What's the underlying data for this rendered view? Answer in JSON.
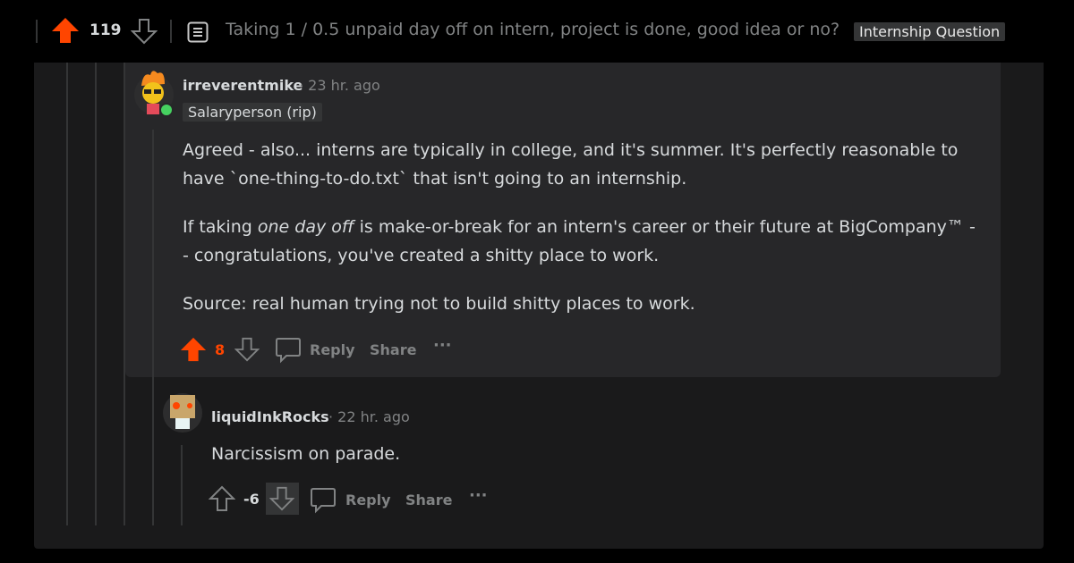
{
  "post": {
    "score": "119",
    "title": "Taking 1 / 0.5 unpaid day off on intern, project is done, good idea or no?",
    "flair": "Internship Question"
  },
  "colors": {
    "upvote": "#ff4500",
    "panel": "#1a1a1b",
    "highlight": "#272729"
  },
  "comments": [
    {
      "author": "irreverentmike",
      "time": "· 23 hr. ago",
      "flair": "Salaryperson (rip)",
      "online": true,
      "p1": "Agreed - also... interns are typically in college, and it's summer. It's perfectly reasonable to have `one-thing-to-do.txt` that isn't going to an internship.",
      "p2_pre": "If taking ",
      "p2_em": "one day off",
      "p2_post": " is make-or-break for an intern's career or their future at BigCompany™ -- congratulations, you've created a shitty place to work.",
      "p3": "Source: real human trying not to build shitty places to work.",
      "score": "8",
      "vote": "up",
      "reply": "Reply",
      "share": "Share",
      "more": "···"
    },
    {
      "author": "liquidInkRocks",
      "time": "· 22 hr. ago",
      "body": "Narcissism on parade.",
      "score": "-6",
      "vote": "down",
      "reply": "Reply",
      "share": "Share",
      "more": "···"
    }
  ]
}
